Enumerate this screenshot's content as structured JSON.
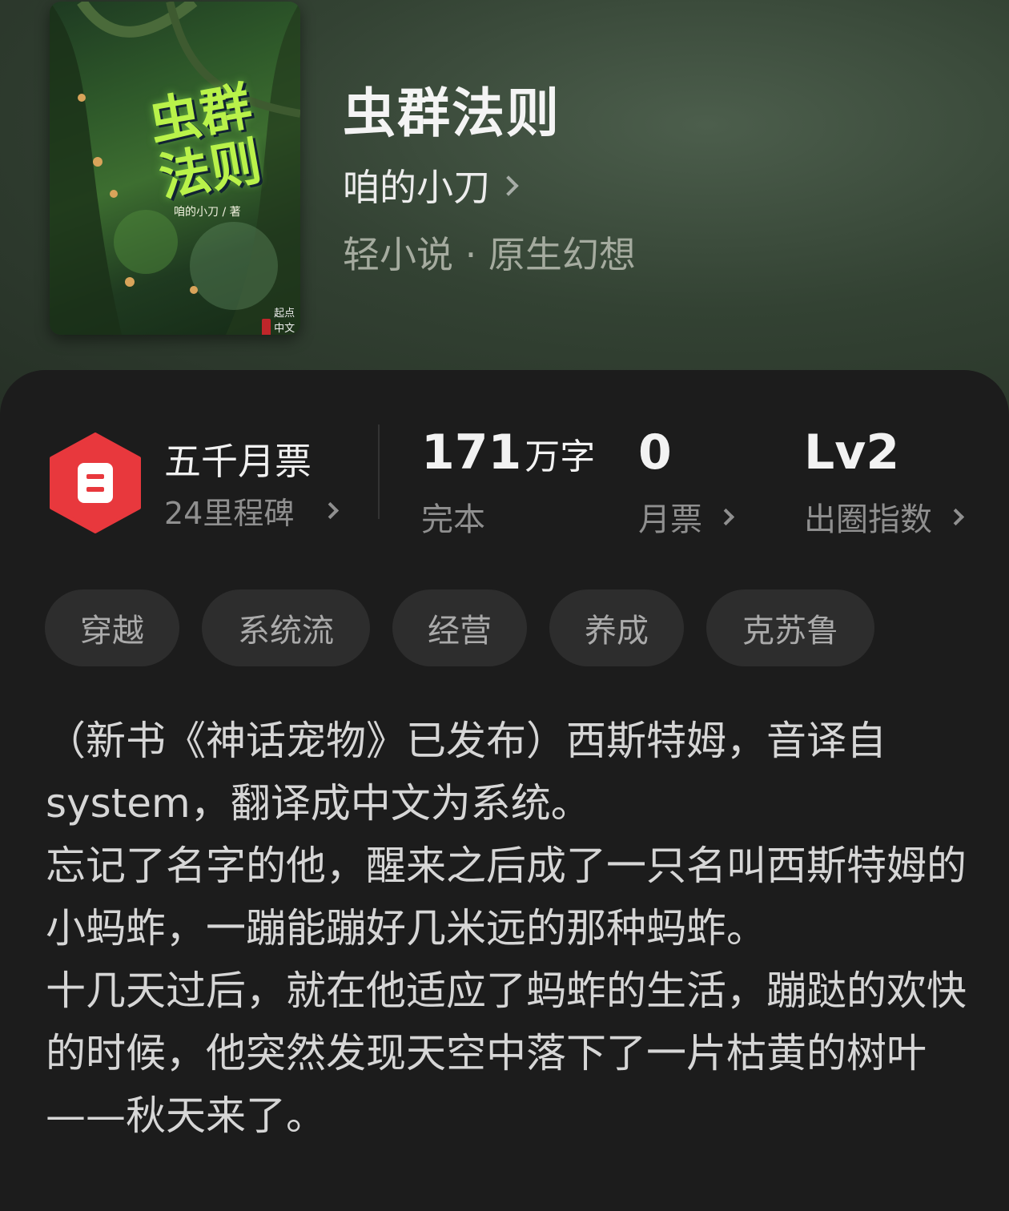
{
  "book": {
    "title": "虫群法则",
    "author": "咱的小刀",
    "genre": "轻小说 · 原生幻想",
    "cover": {
      "title_line1": "虫群",
      "title_line2": "法则",
      "byline": "咱的小刀 / 著",
      "publisher": "起点中文网"
    }
  },
  "badge": {
    "title": "五千月票",
    "subtitle": "24里程碑",
    "color": "#e8383d"
  },
  "stats": [
    {
      "value": "171",
      "unit": "万字",
      "label": "完本"
    },
    {
      "value": "0",
      "unit": "",
      "label": "月票"
    },
    {
      "value": "Lv2",
      "unit": "",
      "label": "出圈指数"
    }
  ],
  "tags": [
    "穿越",
    "系统流",
    "经营",
    "养成",
    "克苏鲁"
  ],
  "description": [
    "（新书《神话宠物》已发布）西斯特姆，音译自system，翻译成中文为系统。",
    "忘记了名字的他，醒来之后成了一只名叫西斯特姆的小蚂蚱，一蹦能蹦好几米远的那种蚂蚱。",
    "十几天过后，就在他适应了蚂蚱的生活，蹦跶的欢快的时候，他突然发现天空中落下了一片枯黄的树叶",
    "——秋天来了。"
  ],
  "icons": [
    "chevron-right-icon",
    "ticket-icon"
  ]
}
